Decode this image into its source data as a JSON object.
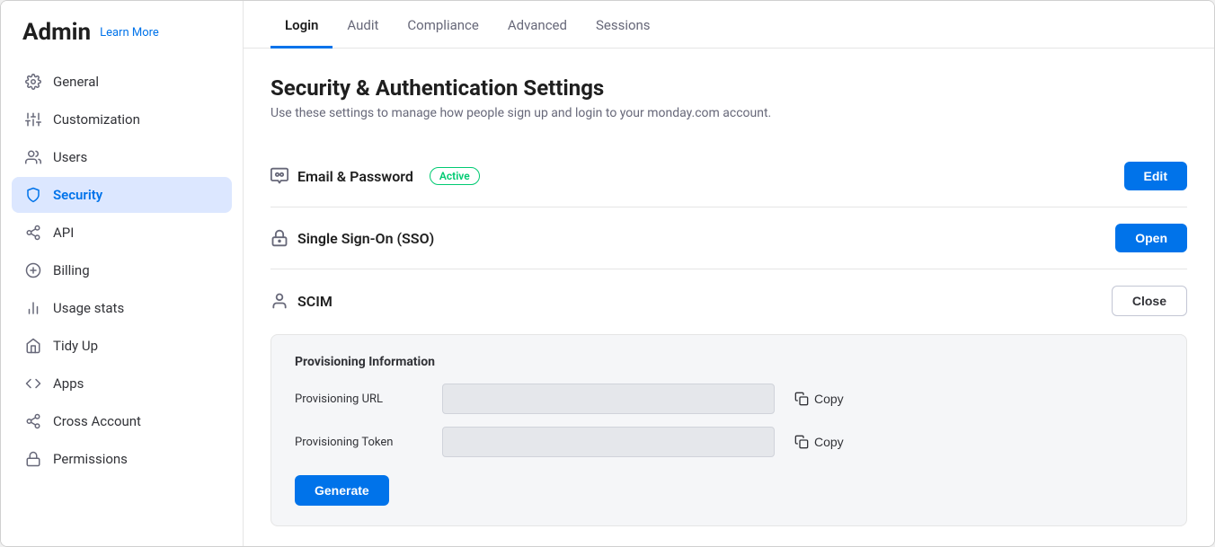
{
  "sidebar": {
    "title": "Admin",
    "learn_more": "Learn More",
    "items": [
      {
        "id": "general",
        "label": "General",
        "icon": "gear"
      },
      {
        "id": "customization",
        "label": "Customization",
        "icon": "sliders"
      },
      {
        "id": "users",
        "label": "Users",
        "icon": "users"
      },
      {
        "id": "security",
        "label": "Security",
        "icon": "shield",
        "active": true
      },
      {
        "id": "api",
        "label": "API",
        "icon": "api"
      },
      {
        "id": "billing",
        "label": "Billing",
        "icon": "dollar"
      },
      {
        "id": "usage-stats",
        "label": "Usage stats",
        "icon": "bar-chart"
      },
      {
        "id": "tidy-up",
        "label": "Tidy Up",
        "icon": "tidy"
      },
      {
        "id": "apps",
        "label": "Apps",
        "icon": "code"
      },
      {
        "id": "cross-account",
        "label": "Cross Account",
        "icon": "cross-account"
      },
      {
        "id": "permissions",
        "label": "Permissions",
        "icon": "lock"
      }
    ]
  },
  "tabs": [
    {
      "id": "login",
      "label": "Login",
      "active": true
    },
    {
      "id": "audit",
      "label": "Audit"
    },
    {
      "id": "compliance",
      "label": "Compliance"
    },
    {
      "id": "advanced",
      "label": "Advanced"
    },
    {
      "id": "sessions",
      "label": "Sessions"
    }
  ],
  "page": {
    "title": "Security & Authentication Settings",
    "subtitle": "Use these settings to manage how people sign up and login to your monday.com account."
  },
  "sections": [
    {
      "id": "email-password",
      "label": "Email & Password",
      "icon": "email-icon",
      "badge": "Active",
      "button_label": "Edit",
      "button_type": "primary"
    },
    {
      "id": "sso",
      "label": "Single Sign-On (SSO)",
      "icon": "lock-icon",
      "button_label": "Open",
      "button_type": "primary"
    },
    {
      "id": "scim",
      "label": "SCIM",
      "icon": "user-icon",
      "button_label": "Close",
      "button_type": "outline",
      "expanded": true
    }
  ],
  "scim": {
    "section_title": "Provisioning Information",
    "fields": [
      {
        "id": "provisioning-url",
        "label": "Provisioning URL",
        "value": "",
        "copy_label": "Copy"
      },
      {
        "id": "provisioning-token",
        "label": "Provisioning Token",
        "value": "",
        "copy_label": "Copy"
      }
    ],
    "generate_label": "Generate"
  }
}
